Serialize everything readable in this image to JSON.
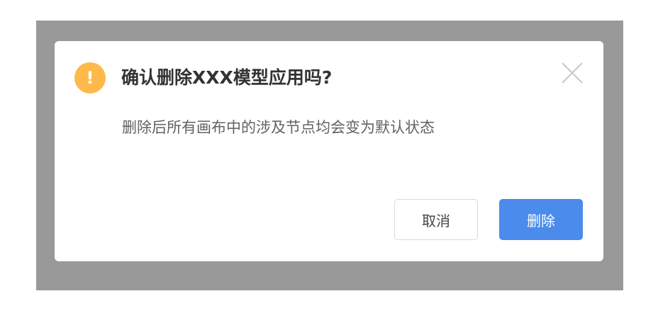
{
  "dialog": {
    "warning_icon_glyph": "!",
    "title": "确认删除XXX模型应用吗?",
    "message": "删除后所有画布中的涉及节点均会变为默认状态",
    "close_icon": "close-icon",
    "buttons": {
      "cancel_label": "取消",
      "delete_label": "删除"
    }
  },
  "colors": {
    "overlay": "#999999",
    "warning": "#ffb94a",
    "primary": "#4a8bec"
  }
}
